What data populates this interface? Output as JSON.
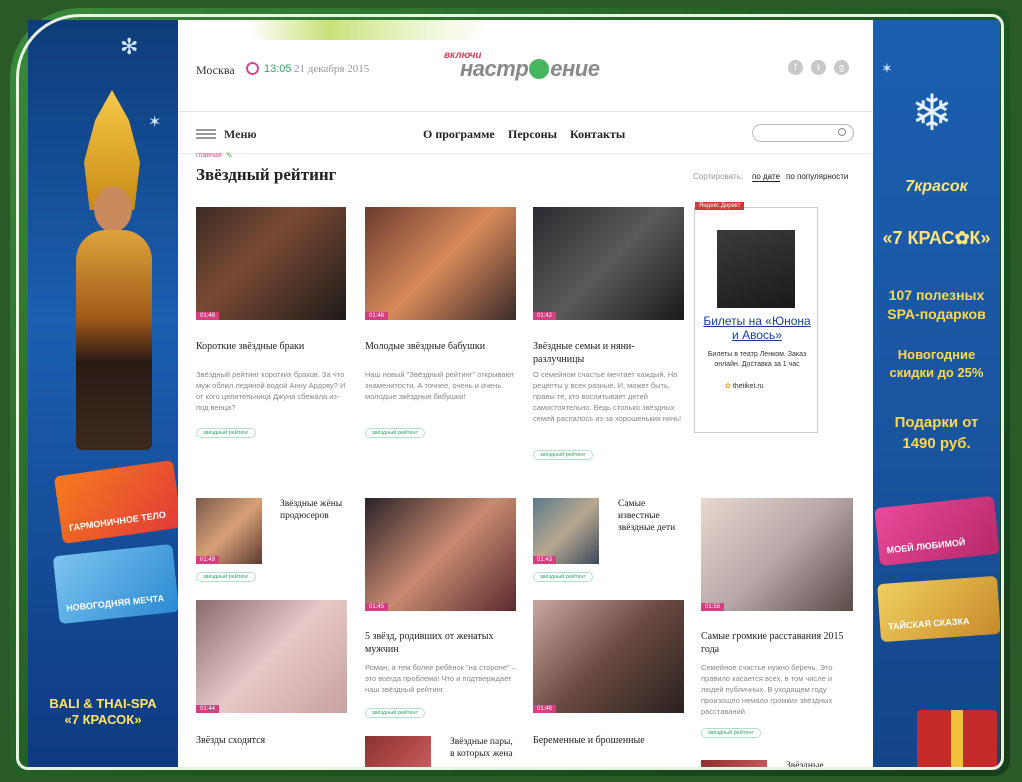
{
  "left_ad": {
    "card1": "ГАРМОНИЧНОЕ ТЕЛО",
    "card2": "НОВОГОДНЯЯ МЕЧТА",
    "footer_line1": "BALI & THAI-SPA",
    "footer_line2": "«7 КРАСОК»"
  },
  "right_ad": {
    "brand_small": "7красок",
    "brand": "«7 КРАС✿К»",
    "line1": "107 полезных SPA-подарков",
    "line2": "Новогодние скидки до 25%",
    "line3": "Подарки от 1490 руб.",
    "card1": "МОЕЙ ЛЮБИМОЙ",
    "card2": "ТАЙСКАЯ СКАЗКА"
  },
  "header": {
    "city": "Москва",
    "time": "13:05",
    "date": "21 декабря 2015",
    "logo_top": "включи",
    "logo_a": "настр",
    "logo_b": "ение",
    "social": [
      "f",
      "t",
      "g"
    ]
  },
  "nav": {
    "menu_label": "Меню",
    "items": [
      "О программе",
      "Персоны",
      "Контакты"
    ]
  },
  "page": {
    "breadcrumb": "главная",
    "title": "Звёздный рейтинг",
    "sort_label": "Сортировать:",
    "sort_date": "по дате",
    "sort_pop": "по популярности"
  },
  "cards": [
    {
      "title": "Короткие звёздные браки",
      "desc": "Звёздный рейтинг коротких браков. За что муж облил ледяной водой Анну Ардову? И от кого целительница Джуна сбежала из-под венца?",
      "dur": "01:46",
      "tag": "звёздный рейтинг"
    },
    {
      "title": "Молодые звёздные бабушки",
      "desc": "Наш новый \"Звёздный рейтинг\" открывают знаменитости. А точнее, очень и очень молодые звёздные бабушки!",
      "dur": "01:48",
      "tag": "звёздный рейтинг"
    },
    {
      "title": "Звёздные семьи и няни-разлучницы",
      "desc": "О семейном счастье мечтает каждый. Но рецепты у всех разные. И, может быть, правы те, кто воспитывает детей самостоятельно. Ведь столько звёздных семей распалось из-за хорошеньких нянь!",
      "dur": "01:42",
      "tag": "звёздный рейтинг"
    },
    {
      "title": "Звёздные жёны продюсеров",
      "dur": "01:49",
      "tag": "звёздный рейтинг"
    },
    {
      "title": "5 звёзд, родивших от женатых мужчин",
      "desc": "Роман, а тем более ребёнок \"на стороне\" – это всегда проблема! Что и подтверждает наш звёздный рейтинг.",
      "dur": "01:45",
      "tag": "звёздный рейтинг"
    },
    {
      "title": "Самые известные звёздные дети",
      "dur": "01:43",
      "tag": "звёздный рейтинг"
    },
    {
      "title": "Самые громкие расставания 2015 года",
      "desc": "Семейное счастье нужно беречь. Это правило касается всех, в том числе и людей публичных. В уходящем году произошло немало громких звёздных расставаний.",
      "dur": "01:58",
      "tag": "звёздный рейтинг"
    },
    {
      "title": "Звёзды сходятся",
      "dur": "01:44"
    },
    {
      "title": "Беременные и брошенные",
      "dur": "01:46"
    },
    {
      "title": "Звёздные пары, в которых жена"
    },
    {
      "title": "Звёздные"
    }
  ],
  "yandex_ad": {
    "label": "Яндекс.Директ",
    "title": "Билеты на «Юнона и Авось»",
    "text": "Билеты в театр Ленком. Заказ онлайн. Доставка за 1 час",
    "site": "thetiket.ru"
  }
}
